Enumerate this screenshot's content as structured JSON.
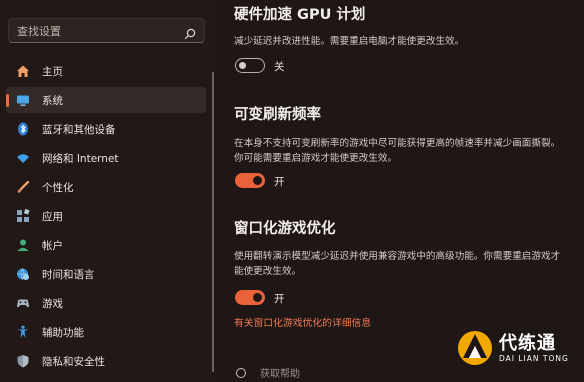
{
  "search": {
    "placeholder": "查找设置"
  },
  "sidebar": {
    "items": [
      {
        "label": "主页",
        "icon": "home-icon"
      },
      {
        "label": "系统",
        "icon": "system-display-icon",
        "active": true
      },
      {
        "label": "蓝牙和其他设备",
        "icon": "bluetooth-icon"
      },
      {
        "label": "网络和 Internet",
        "icon": "wifi-icon"
      },
      {
        "label": "个性化",
        "icon": "brush-icon"
      },
      {
        "label": "应用",
        "icon": "apps-icon"
      },
      {
        "label": "帐户",
        "icon": "account-icon"
      },
      {
        "label": "时间和语言",
        "icon": "globe-clock-icon"
      },
      {
        "label": "游戏",
        "icon": "gamepad-icon"
      },
      {
        "label": "辅助功能",
        "icon": "accessibility-icon"
      },
      {
        "label": "隐私和安全性",
        "icon": "shield-icon"
      }
    ]
  },
  "main": {
    "gpu": {
      "title": "硬件加速 GPU 计划",
      "description": "减少延迟并改进性能。需要重启电脑才能使更改生效。",
      "toggle_label": "关",
      "toggle_on": false
    },
    "vrr": {
      "title": "可变刷新频率",
      "description": "在本身不支持可变刷新率的游戏中尽可能获得更高的帧速率并减少画面撕裂。你可能需要重启游戏才能使更改生效。",
      "toggle_label": "开",
      "toggle_on": true
    },
    "windowed": {
      "title": "窗口化游戏优化",
      "description": "使用翻转演示模型减少延迟并使用兼容游戏中的高级功能。你需要重启游戏才能使更改生效。",
      "toggle_label": "开",
      "toggle_on": true,
      "link": "有关窗口化游戏优化的详细信息"
    },
    "help_label": "获取帮助"
  },
  "watermark": {
    "text": "代练通",
    "subtext": "DAI LIAN TONG"
  },
  "colors": {
    "accent": "#e9623a",
    "background": "#1f1715",
    "link": "#f07a52"
  }
}
